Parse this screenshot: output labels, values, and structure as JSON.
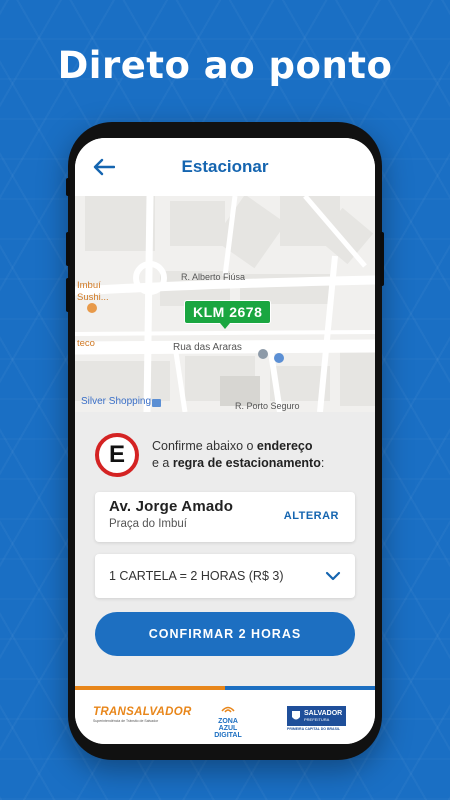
{
  "headline": "Direto ao ponto",
  "app": {
    "title": "Estacionar"
  },
  "map": {
    "plate": "KLM 2678",
    "labels": {
      "street1": "R. Alberto Fiúsa",
      "poi_imbui": "Imbuí",
      "poi_sushi": "Sushi...",
      "poi_teco": "teco",
      "street2": "Rua das Araras",
      "shop": "Silver Shopping",
      "street3": "R. Porto Seguro"
    }
  },
  "confirm": {
    "line1_prefix": "Confirme abaixo o ",
    "line1_bold": "endereço",
    "line2_prefix": "e a ",
    "line2_bold": "regra de estacionamento",
    "line2_suffix": ":",
    "sign_letter": "E"
  },
  "address": {
    "street": "Av. Jorge Amado",
    "place": "Praça do Imbuí",
    "change_label": "ALTERAR"
  },
  "rule_select": {
    "selected": "1 CARTELA = 2 HORAS (R$ 3)"
  },
  "cta_label": "CONFIRMAR 2 HORAS",
  "footer": {
    "transalvador": "TRANSALVADOR",
    "transalvador_sub": "Superintendência de Trânsito de Salvador",
    "zona_line1": "ZONA",
    "zona_line2": "AZUL",
    "zona_line3": "DIGITAL",
    "salvador": "SALVADOR",
    "salvador_sub_badge": "PREFEITURA",
    "salvador_sub": "PRIMEIRA CAPITAL DO BRASIL",
    "stripe_colors": [
      "#e8861a",
      "#e8861a",
      "#1d6fc1",
      "#1d6fc1"
    ]
  },
  "colors": {
    "background": "#1a6fc4",
    "accent": "#1565b0",
    "plate_green": "#1aa640",
    "sign_red": "#d42323"
  }
}
